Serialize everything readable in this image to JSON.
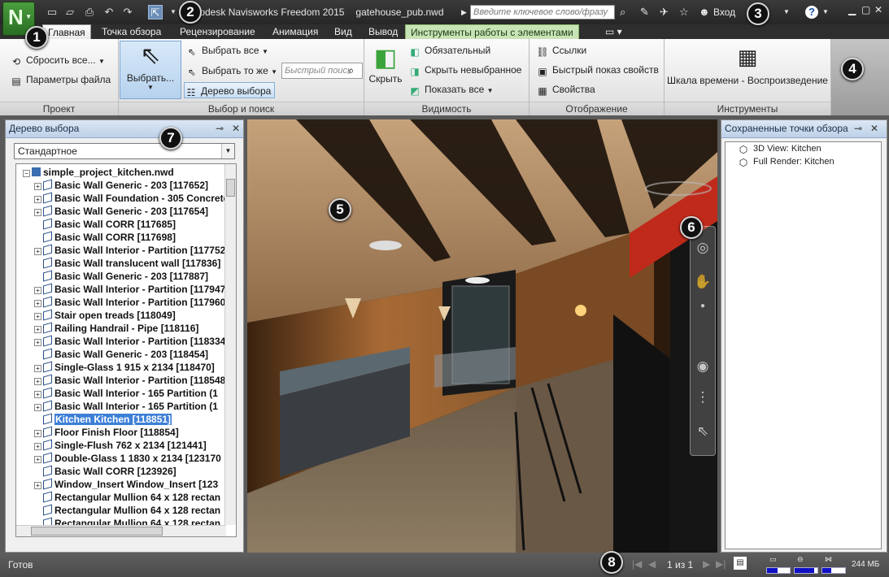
{
  "window": {
    "title": "...todesk Navisworks Freedom 2015",
    "file": "gatehouse_pub.nwd",
    "search_placeholder": "Введите ключевое слово/фразу",
    "login": "Вход"
  },
  "badges": [
    "1",
    "2",
    "3",
    "4",
    "5",
    "6",
    "7",
    "8"
  ],
  "tabs": [
    "Главная",
    "Точка обзора",
    "Рецензирование",
    "Анимация",
    "Вид",
    "Вывод",
    "Инструменты работы с элементами"
  ],
  "ribbon": {
    "project": {
      "label": "Проект",
      "reset": "Сбросить все...",
      "params": "Параметры файла"
    },
    "select": {
      "label": "Выбор и поиск",
      "select_btn": "Выбрать...",
      "select_all": "Выбрать все",
      "select_same": "Выбрать то же",
      "tree": "Дерево выбора",
      "quick_search_placeholder": "Быстрый поиск"
    },
    "visibility": {
      "label": "Видимость",
      "hide": "Скрыть",
      "required": "Обязательный",
      "hide_unselected": "Скрыть невыбранное",
      "show_all": "Показать все"
    },
    "display": {
      "label": "Отображение",
      "links": "Ссылки",
      "quick_props": "Быстрый показ свойств",
      "props": "Свойства"
    },
    "tools": {
      "label": "Инструменты",
      "timeline": "Шкала времени - Воспроизведение"
    }
  },
  "left_panel": {
    "title": "Дерево выбора",
    "combo": "Стандартное",
    "root": "simple_project_kitchen.nwd",
    "items": [
      {
        "label": "Basic Wall Generic - 203 [117652]",
        "exp": true,
        "sel": false
      },
      {
        "label": "Basic Wall Foundation - 305 Concrete",
        "exp": true,
        "sel": false
      },
      {
        "label": "Basic Wall Generic - 203 [117654]",
        "exp": true,
        "sel": false
      },
      {
        "label": "Basic Wall CORR [117685]",
        "exp": false,
        "sel": false
      },
      {
        "label": "Basic Wall CORR [117698]",
        "exp": false,
        "sel": false
      },
      {
        "label": "Basic Wall Interior - Partition [117752",
        "exp": true,
        "sel": false
      },
      {
        "label": "Basic Wall translucent wall [117836]",
        "exp": false,
        "sel": false
      },
      {
        "label": "Basic Wall Generic - 203 [117887]",
        "exp": false,
        "sel": false
      },
      {
        "label": "Basic Wall Interior - Partition [117947",
        "exp": true,
        "sel": false
      },
      {
        "label": "Basic Wall Interior - Partition [117960",
        "exp": true,
        "sel": false
      },
      {
        "label": "Stair open treads [118049]",
        "exp": true,
        "sel": false
      },
      {
        "label": "Railing Handrail - Pipe [118116]",
        "exp": true,
        "sel": false
      },
      {
        "label": "Basic Wall Interior - Partition [118334",
        "exp": true,
        "sel": false
      },
      {
        "label": "Basic Wall Generic - 203 [118454]",
        "exp": false,
        "sel": false
      },
      {
        "label": "Single-Glass 1 915 x 2134 [118470]",
        "exp": true,
        "sel": false
      },
      {
        "label": "Basic Wall Interior - Partition [118548",
        "exp": true,
        "sel": false
      },
      {
        "label": "Basic Wall Interior - 165 Partition (1",
        "exp": true,
        "sel": false
      },
      {
        "label": "Basic Wall Interior - 165 Partition (1",
        "exp": true,
        "sel": false
      },
      {
        "label": "Kitchen Kitchen [118851]",
        "exp": false,
        "sel": true
      },
      {
        "label": "Floor Finish Floor [118854]",
        "exp": true,
        "sel": false
      },
      {
        "label": "Single-Flush 762 x 2134 [121441]",
        "exp": true,
        "sel": false
      },
      {
        "label": "Double-Glass 1 1830 x 2134 [123170",
        "exp": true,
        "sel": false
      },
      {
        "label": "Basic Wall CORR [123926]",
        "exp": false,
        "sel": false
      },
      {
        "label": "Window_Insert Window_Insert [123",
        "exp": true,
        "sel": false
      },
      {
        "label": "Rectangular Mullion 64 x 128 rectan",
        "exp": false,
        "sel": false
      },
      {
        "label": "Rectangular Mullion 64 x 128 rectan",
        "exp": false,
        "sel": false
      },
      {
        "label": "Rectangular Mullion 64 x 128 rectan",
        "exp": false,
        "sel": false
      }
    ]
  },
  "right_panel": {
    "title": "Сохраненные точки обзора",
    "items": [
      "3D View: Kitchen",
      "Full Render: Kitchen"
    ]
  },
  "status": {
    "ready": "Готов",
    "page": "1 из 1",
    "memory": "244 МБ",
    "bars": [
      0.45,
      0.85,
      0.4
    ]
  }
}
